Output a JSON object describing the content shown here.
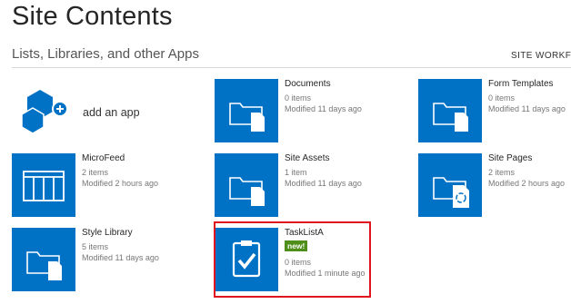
{
  "page": {
    "title": "Site Contents",
    "section_title": "Lists, Libraries, and other Apps",
    "workflows_label": "SITE WORKF"
  },
  "add_app": {
    "label": "add an app"
  },
  "apps": {
    "documents": {
      "name": "Documents",
      "count": "0 items",
      "modified": "Modified 11 days ago"
    },
    "form_templates": {
      "name": "Form Templates",
      "count": "0 items",
      "modified": "Modified 11 days ago"
    },
    "microfeed": {
      "name": "MicroFeed",
      "count": "2 items",
      "modified": "Modified 2 hours ago"
    },
    "site_assets": {
      "name": "Site Assets",
      "count": "1 item",
      "modified": "Modified 11 days ago"
    },
    "site_pages": {
      "name": "Site Pages",
      "count": "2 items",
      "modified": "Modified 2 hours ago"
    },
    "style_library": {
      "name": "Style Library",
      "count": "5 items",
      "modified": "Modified 11 days ago"
    },
    "tasklista": {
      "name": "TaskListA",
      "badge": "new!",
      "count": "0 items",
      "modified": "Modified 1 minute ago"
    }
  },
  "colors": {
    "tile_blue": "#0072c6",
    "badge_green": "#4f8f19",
    "highlight_red": "#e0141e"
  },
  "icons": [
    "folder-doc-icon",
    "list-grid-icon",
    "recycle-doc-icon",
    "task-check-icon",
    "add-app-icon",
    "workflow-icon"
  ]
}
